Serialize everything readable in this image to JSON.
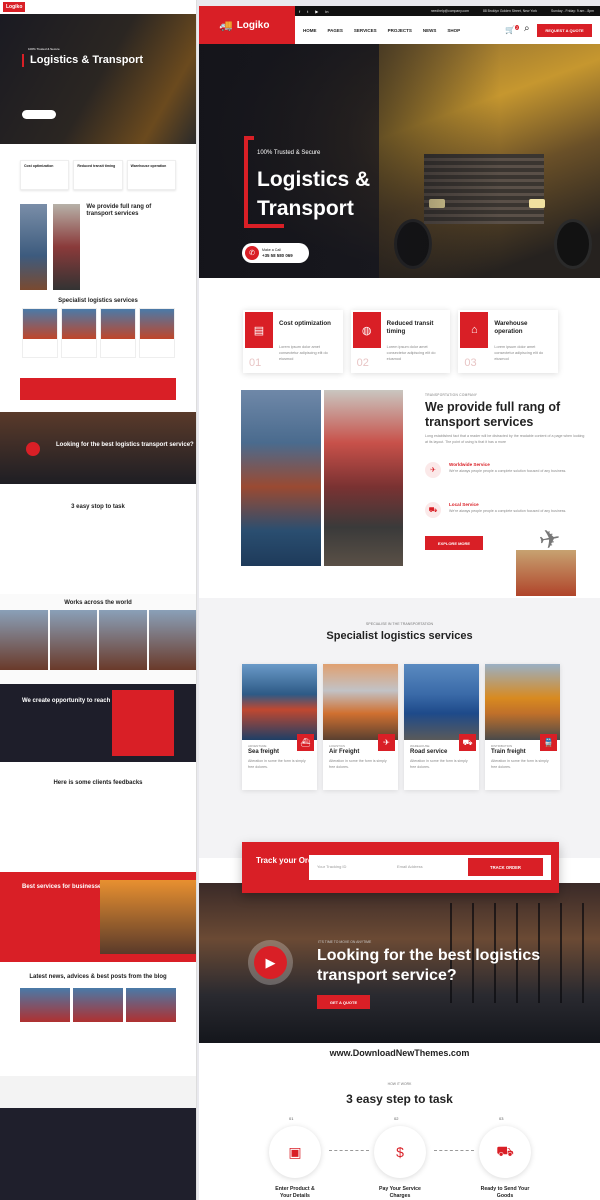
{
  "left": {
    "logo": "Logiko",
    "hero_tag": "100% Trusted & Secure",
    "hero_title": "Logistics & Transport",
    "features": [
      "Cost optimization",
      "Reduced transit timing",
      "Warehouse operation"
    ],
    "about_title": "We provide full rang of transport services",
    "services_title": "Specialist logistics services",
    "service_names": [
      "Sea freight",
      "Air Freight",
      "Road service",
      "Train freight"
    ],
    "track": "Track your Order",
    "video_title": "Looking for the best logistics transport service?",
    "steps_title": "3 easy stop to task",
    "works_title": "Works across the world",
    "opportunity": "We create opportunity to reach potential",
    "feedback": "Here is some clients feedbacks",
    "best": "Best services for businesses",
    "blog": "Latest news, advices & best posts from the blog"
  },
  "topbar": {
    "social": [
      "f",
      "t",
      "▶",
      "in"
    ],
    "email": "needhelp@company.com",
    "address": "88 Broklyn Golden Street, New York",
    "hours": "Sunday - Friday: 9 am - 8pm"
  },
  "nav": {
    "logo": "Logiko",
    "menu": [
      "HOME",
      "PAGES",
      "SERVICES",
      "PROJECTS",
      "NEWS",
      "SHOP"
    ],
    "cart_count": "2",
    "quote": "REQUEST A QUOTE"
  },
  "hero": {
    "tag": "100% Trusted & Secure",
    "title": "Logistics & Transport",
    "call_label": "Make a Call",
    "phone": "+35 58 580 069"
  },
  "features": [
    {
      "title": "Cost optimization",
      "text": "Lorem ipsum dolor amet consectetur adipiscing elit do eiusmod",
      "num": "01"
    },
    {
      "title": "Reduced transit timing",
      "text": "Lorem ipsum dolor amet consectetur adipiscing elit do eiusmod",
      "num": "02"
    },
    {
      "title": "Warehouse operation",
      "text": "Lorem ipsum dolor amet consectetur adipiscing elit do eiusmod",
      "num": "03"
    }
  ],
  "about": {
    "small": "TRANSPORTATION COMPANY",
    "title": "We provide full rang of transport services",
    "desc": "Long established fact that a reader will be distracted by the readable content of a page when looking at its layout. The point of using is that it has a more",
    "items": [
      {
        "title": "Worldwide Service",
        "text": "We're always people people a complete solution focused of any business."
      },
      {
        "title": "Local Service",
        "text": "We're always people people a complete solution focused of any business."
      }
    ],
    "button": "EXPLORE MORE"
  },
  "services": {
    "small": "SPECIALISE IN THE TRANSPORTATION",
    "title": "Specialist logistics services",
    "items": [
      {
        "cat": "ADVENTURE",
        "name": "Sea freight",
        "text": "Alteration in some the form is simply free dolores."
      },
      {
        "cat": "LOGISTICS",
        "name": "Air Freight",
        "text": "Alteration in some the form is simply free dolores."
      },
      {
        "cat": "WAREHOUSE",
        "name": "Road service",
        "text": "Alteration in some the form is simply free dolores."
      },
      {
        "cat": "DISTRIBUTION",
        "name": "Train freight",
        "text": "Alteration in some the form is simply free dolores."
      }
    ]
  },
  "track": {
    "label": "Track your Order",
    "tracking_placeholder": "Your Tracking ID",
    "email_placeholder": "Email Address",
    "button": "TRACK ORDER"
  },
  "video": {
    "small": "IT'S TIME TO MOVE ON ANYTIME",
    "title": "Looking for the best logistics transport service?",
    "button": "GET A QUOTE"
  },
  "watermark": "www.DownloadNewThemes.com",
  "steps": {
    "small": "HOW IT WORK",
    "title": "3 easy step to task",
    "items": [
      {
        "num": "01",
        "label": "Enter Product & Your Details"
      },
      {
        "num": "02",
        "label": "Pay Your Service Charges"
      },
      {
        "num": "03",
        "label": "Ready to Send Your Goods"
      }
    ]
  }
}
